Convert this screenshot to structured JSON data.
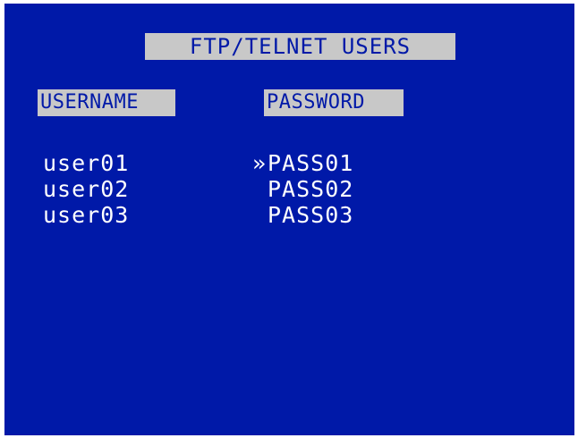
{
  "title": "FTP/TELNET USERS",
  "headers": {
    "username": "USERNAME",
    "password": "PASSWORD"
  },
  "selected_row": 0,
  "selection_marker": "»",
  "users": [
    {
      "username": "user01",
      "password": "PASS01"
    },
    {
      "username": "user02",
      "password": "PASS02"
    },
    {
      "username": "user03",
      "password": "PASS03"
    }
  ],
  "colors": {
    "background": "#0019a8",
    "highlight": "#c8c8c8",
    "text": "#ffffff"
  }
}
